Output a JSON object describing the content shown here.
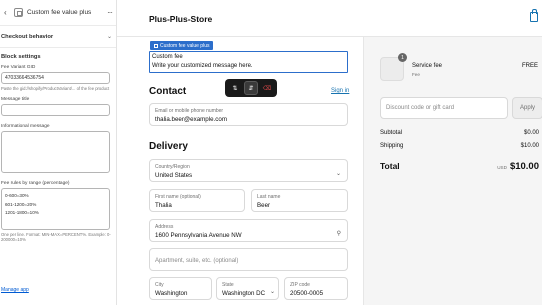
{
  "panel": {
    "title": "Custom fee value plus",
    "more_label": "···",
    "section": "Checkout behavior",
    "block_title": "Block settings",
    "variant_label": "Fee Variant GID",
    "variant_value": "47033664536754",
    "variant_help": "Paste the gid://shopify/ProductVariant/... of the fee product",
    "message_title_label": "Message title",
    "message_title_value": "",
    "info_label": "Informational message",
    "info_value": "",
    "rules_label": "Fee rules by range (percentage)",
    "rules_value": "0-600=30%\n601-1200=20%\n1201-1800=10%",
    "rules_help": "One per line. Format: MIN-MAX=PERCENT%. Example: 0-200000=10%",
    "manage_label": "Manage app"
  },
  "header": {
    "store_name": "Plus-Plus-Store",
    "bag_icon": "shopping-bag-icon"
  },
  "block": {
    "badge_label": "Custom fee value plus",
    "title": "Custom fee",
    "message": "Write your customized message here."
  },
  "toolbar": {
    "icons": [
      "move-up-icon",
      "move-down-icon",
      "delete-icon"
    ]
  },
  "contact": {
    "heading": "Contact",
    "signin_label": "Sign in",
    "email_label": "Email or mobile phone number",
    "email_value": "thalia.beer@example.com"
  },
  "delivery": {
    "heading": "Delivery",
    "country_label": "Country/Region",
    "country_value": "United States",
    "first_label": "First name (optional)",
    "first_value": "Thalia",
    "last_label": "Last name",
    "last_value": "Beer",
    "address_label": "Address",
    "address_value": "1600 Pennsylvania Avenue NW",
    "apt_placeholder": "Apartment, suite, etc. (optional)",
    "city_label": "City",
    "city_value": "Washington",
    "state_label": "State",
    "state_value": "Washington DC",
    "zip_label": "ZIP code",
    "zip_value": "20500-0005"
  },
  "summary": {
    "item_qty": "1",
    "item_name": "Service fee",
    "item_sub": "Fee",
    "item_price": "FREE",
    "discount_placeholder": "Discount code or gift card",
    "apply_label": "Apply",
    "subtotal_label": "Subtotal",
    "subtotal_value": "$0.00",
    "shipping_label": "Shipping",
    "shipping_value": "$10.00",
    "total_label": "Total",
    "total_currency": "USD",
    "total_value": "$10.00"
  },
  "colors": {
    "accent": "#2c6ecb",
    "link": "#1773b0",
    "toolbar_bg": "#1a1a1a",
    "delete": "#e34b4b"
  }
}
